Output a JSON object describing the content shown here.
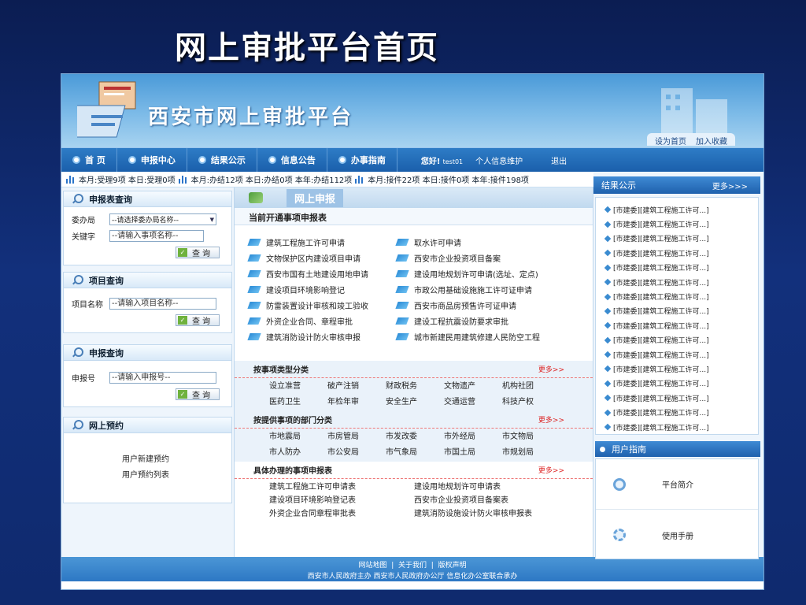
{
  "slide_title": "网上审批平台首页",
  "site_title": "西安市网上审批平台",
  "top_links": [
    "设为首页",
    "加入收藏"
  ],
  "nav": {
    "items": [
      "首 页",
      "申报中心",
      "结果公示",
      "信息公告",
      "办事指南"
    ],
    "greeting": "您好!",
    "username": "test01",
    "profile": "个人信息维护",
    "logout": "退出"
  },
  "stats": [
    "本月:受理9项 本日:受理0项",
    "本月:办结12项 本日:办结0项 本年:办结112项",
    "本月:接件22项 本日:接件0项 本年:接件198项"
  ],
  "left": {
    "form_query": {
      "title": "申报表查询",
      "bureau_label": "委办局",
      "bureau_value": "--请选择委办局名称--",
      "keyword_label": "关键字",
      "keyword_placeholder": "--请输入事项名称--",
      "button": "查 询"
    },
    "project_query": {
      "title": "项目查询",
      "label": "项目名称",
      "placeholder": "--请输入项目名称--",
      "button": "查 询"
    },
    "report_query": {
      "title": "申报查询",
      "label": "申报号",
      "placeholder": "--请输入申报号--",
      "button": "查 询"
    },
    "reservation": {
      "title": "网上预约",
      "links": [
        "用户新建预约",
        "用户预约列表"
      ]
    }
  },
  "center": {
    "header": "网上申报",
    "subheader": "当前开通事项申报表",
    "services": [
      "建筑工程施工许可申请",
      "取水许可申请",
      "文物保护区内建设项目申请",
      "西安市企业投资项目备案",
      "西安市国有土地建设用地申请",
      "建设用地规划许可申请(选址、定点)",
      "建设项目环境影响登记",
      "市政公用基础设施施工许可证申请",
      "防雷装置设计审核和竣工验收",
      "西安市商品房预售许可证申请",
      "外资企业合同、章程审批",
      "建设工程抗震设防要求审批",
      "建筑消防设计防火审核申报",
      "城市新建民用建筑修建人民防空工程"
    ],
    "by_type": {
      "title": "按事项类型分类",
      "more": "更多>>",
      "items": [
        "设立准营",
        "破产注销",
        "财政税务",
        "文物遗产",
        "机构社团",
        "医药卫生",
        "年检年审",
        "安全生产",
        "交通运营",
        "科技产权"
      ]
    },
    "by_dept": {
      "title": "按提供事项的部门分类",
      "more": "更多>>",
      "items": [
        "市地震局",
        "市房管局",
        "市发改委",
        "市外经局",
        "市文物局",
        "市人防办",
        "市公安局",
        "市气象局",
        "市国土局",
        "市规划局"
      ]
    },
    "forms": {
      "title": "具体办理的事项申报表",
      "more": "更多>>",
      "items": [
        "建筑工程施工许可申请表",
        "建设用地规划许可申请表",
        "建设项目环境影响登记表",
        "西安市企业投资项目备案表",
        "外资企业合同章程审批表",
        "建筑消防设施设计防火审核申报表"
      ]
    }
  },
  "right": {
    "results": {
      "title": "结果公示",
      "more": "更多>>>",
      "item": "[市建委][建筑工程施工许可...]",
      "count": 16
    },
    "guide": {
      "title": "用户指南",
      "items": [
        "平台简介",
        "使用手册"
      ]
    }
  },
  "footer": {
    "links": [
      "网站地图",
      "关于我们",
      "版权声明"
    ],
    "line2": "西安市人民政府主办 西安市人民政府办公厅 信息化办公室联合承办"
  }
}
